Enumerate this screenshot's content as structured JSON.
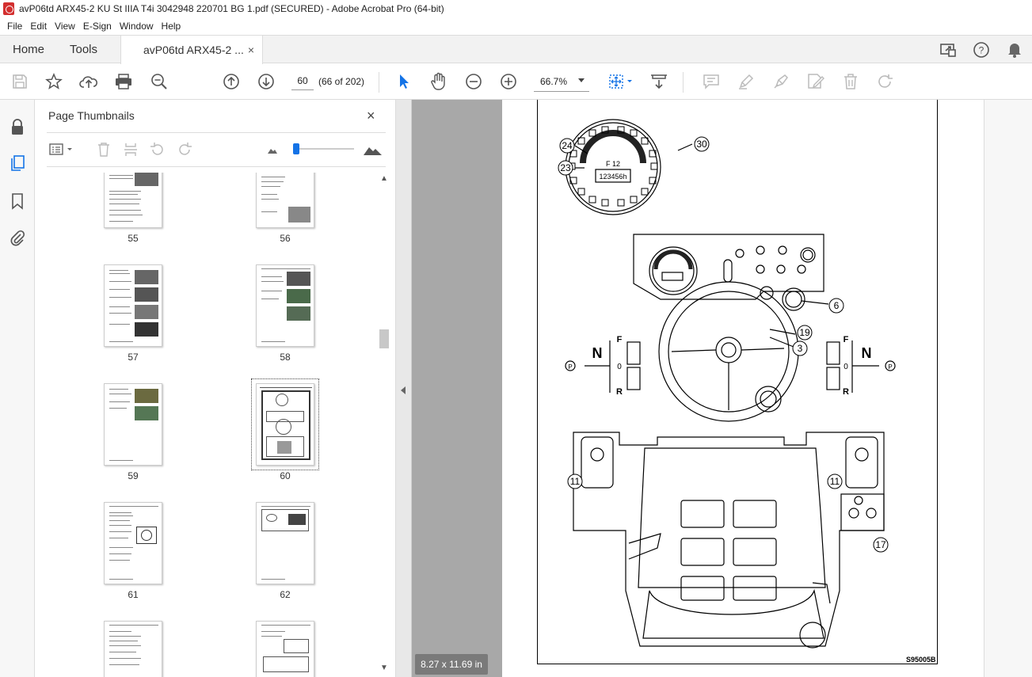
{
  "window": {
    "title": "avP06td ARX45-2 KU St IIIA T4i 3042948 220701 BG 1.pdf (SECURED) - Adobe Acrobat Pro (64-bit)"
  },
  "menu": [
    "File",
    "Edit",
    "View",
    "E-Sign",
    "Window",
    "Help"
  ],
  "tabs": {
    "home": "Home",
    "tools": "Tools",
    "document": "avP06td ARX45-2 ...",
    "close": "×"
  },
  "toolbar": {
    "page_number": "60",
    "page_count": "(66 of 202)",
    "zoom": "66.7%"
  },
  "panel": {
    "title": "Page Thumbnails",
    "close": "×",
    "thumbnails": [
      "55",
      "56",
      "57",
      "58",
      "59",
      "60",
      "61",
      "62"
    ],
    "selected": "60"
  },
  "document": {
    "page_size": "8.27 x 11.69 in",
    "figure_code": "S95005B",
    "callouts": [
      "24",
      "30",
      "23",
      "6",
      "19",
      "3",
      "11",
      "11",
      "17"
    ],
    "gear_labels": {
      "forward": "F",
      "neutral": "N",
      "zero": "0",
      "reverse": "R",
      "park": "P"
    },
    "display_readout": "F 12",
    "hour_meter": "123456h"
  },
  "colors": {
    "accent": "#1473e6",
    "canvas": "#a8a8a8",
    "app_icon": "#d32f2f"
  }
}
